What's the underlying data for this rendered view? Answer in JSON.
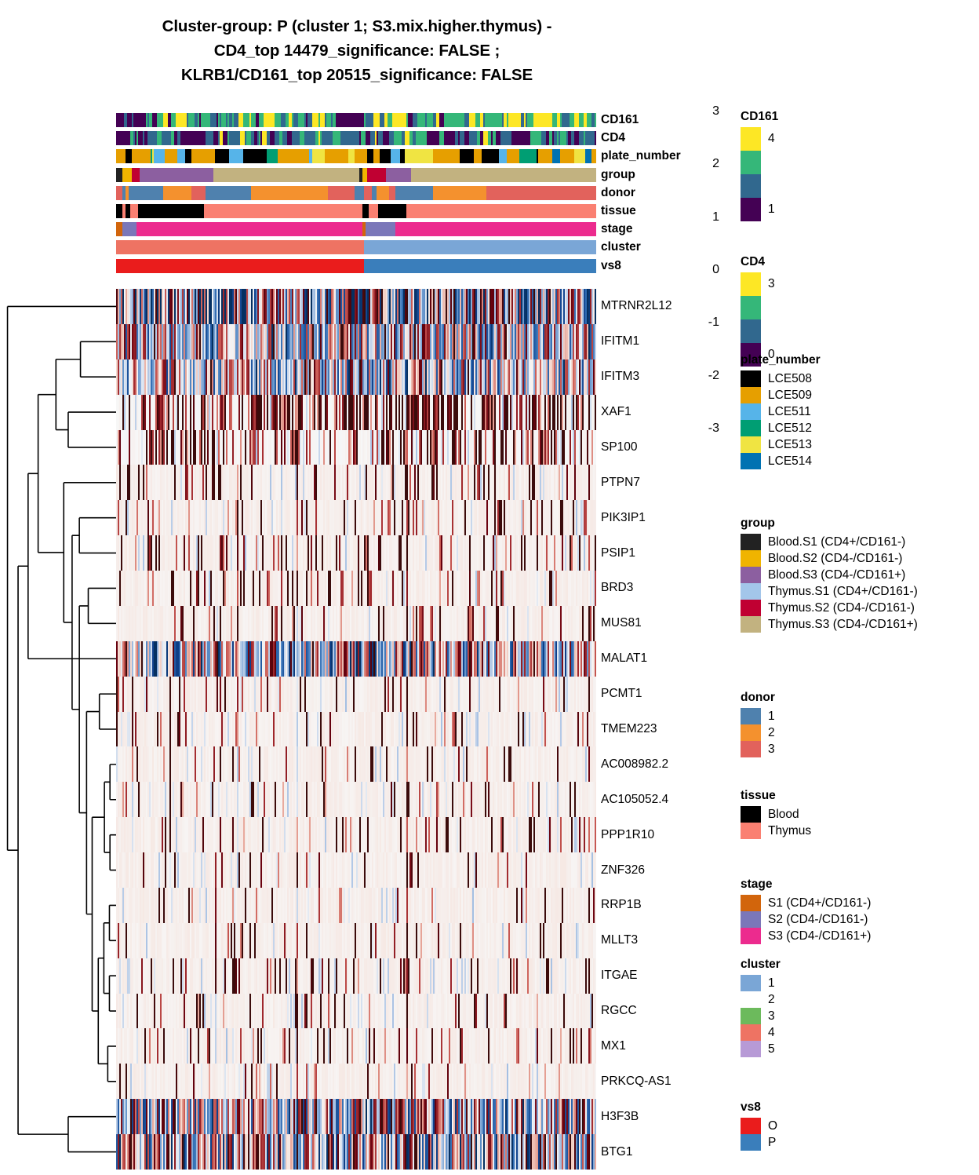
{
  "title": {
    "line1": "Cluster-group: P (cluster 1;  S3.mix.higher.thymus) -",
    "line2": "CD4_top 14479_significance: FALSE ;",
    "line3": "KLRB1/CD161_top 20515_significance: FALSE"
  },
  "annotation_tracks": [
    {
      "name": "CD161",
      "label": "CD161"
    },
    {
      "name": "CD4",
      "label": "CD4"
    },
    {
      "name": "plate_number",
      "label": "plate_number"
    },
    {
      "name": "group",
      "label": "group"
    },
    {
      "name": "donor",
      "label": "donor"
    },
    {
      "name": "tissue",
      "label": "tissue"
    },
    {
      "name": "stage",
      "label": "stage"
    },
    {
      "name": "cluster",
      "label": "cluster"
    },
    {
      "name": "vs8",
      "label": "vs8"
    }
  ],
  "colorbar": {
    "ticks": [
      "3",
      "2",
      "1",
      "0",
      "-1",
      "-2",
      "-3"
    ],
    "min": -3,
    "max": 3,
    "low_color": "#053061",
    "mid_color": "#f7f7f7",
    "high_color": "#3b0b0b"
  },
  "legends": [
    {
      "title": "CD161",
      "style": "stack",
      "items": [
        {
          "label": "4",
          "color": "#fde725"
        },
        {
          "label": "",
          "color": "#35b779"
        },
        {
          "label": "",
          "color": "#31688e"
        },
        {
          "label": "1",
          "color": "#440154"
        }
      ]
    },
    {
      "title": "CD4",
      "style": "stack",
      "items": [
        {
          "label": "3",
          "color": "#fde725"
        },
        {
          "label": "",
          "color": "#35b779"
        },
        {
          "label": "",
          "color": "#31688e"
        },
        {
          "label": "0",
          "color": "#440154"
        }
      ]
    },
    {
      "title": "plate_number",
      "style": "list",
      "items": [
        {
          "label": "LCE508",
          "color": "#000000"
        },
        {
          "label": "LCE509",
          "color": "#e69f00"
        },
        {
          "label": "LCE511",
          "color": "#56b4e9"
        },
        {
          "label": "LCE512",
          "color": "#009e73"
        },
        {
          "label": "LCE513",
          "color": "#f0e442"
        },
        {
          "label": "LCE514",
          "color": "#0072b2"
        }
      ]
    },
    {
      "title": "group",
      "style": "list",
      "items": [
        {
          "label": "Blood.S1 (CD4+/CD161-)",
          "color": "#222222"
        },
        {
          "label": "Blood.S2 (CD4-/CD161-)",
          "color": "#f0b400"
        },
        {
          "label": "Blood.S3 (CD4-/CD161+)",
          "color": "#8c5fa0"
        },
        {
          "label": "Thymus.S1 (CD4+/CD161-)",
          "color": "#a3c6ea"
        },
        {
          "label": "Thymus.S2 (CD4-/CD161-)",
          "color": "#c00032"
        },
        {
          "label": "Thymus.S3 (CD4-/CD161+)",
          "color": "#c2b280"
        }
      ]
    },
    {
      "title": "donor",
      "style": "list",
      "items": [
        {
          "label": "1",
          "color": "#4f81ae"
        },
        {
          "label": "2",
          "color": "#f4912e"
        },
        {
          "label": "3",
          "color": "#e2625c"
        }
      ]
    },
    {
      "title": "tissue",
      "style": "list",
      "items": [
        {
          "label": "Blood",
          "color": "#000000"
        },
        {
          "label": "Thymus",
          "color": "#fa8072"
        }
      ]
    },
    {
      "title": "stage",
      "style": "list",
      "items": [
        {
          "label": "S1 (CD4+/CD161-)",
          "color": "#d2650c"
        },
        {
          "label": "S2 (CD4-/CD161-)",
          "color": "#7b77b9"
        },
        {
          "label": "S3 (CD4-/CD161+)",
          "color": "#ec2b8e"
        }
      ]
    },
    {
      "title": "cluster",
      "style": "list",
      "items": [
        {
          "label": "1",
          "color": "#7aa6d6"
        },
        {
          "label": "2",
          "color": "#fca košice"
        },
        {
          "label": "3",
          "color": "#6cba5c"
        },
        {
          "label": "4",
          "color": "#ee7363"
        },
        {
          "label": "5",
          "color": "#b79ad6"
        }
      ]
    },
    {
      "title": "vs8",
      "style": "list",
      "items": [
        {
          "label": "O",
          "color": "#ea1c1c"
        },
        {
          "label": "P",
          "color": "#3a7ebb"
        }
      ]
    }
  ],
  "chart_data": {
    "type": "heatmap",
    "title": "Cluster-group: P (cluster 1;  S3.mix.higher.thymus) - CD4_top 14479_significance: FALSE ; KLRB1/CD161_top 20515_significance: FALSE",
    "xlabel": "",
    "ylabel": "",
    "zlim": [
      -3,
      3
    ],
    "colormap": "RdBu_r",
    "n_columns": 306,
    "row_labels": [
      "MTRNR2L12",
      "IFITM1",
      "IFITM3",
      "XAF1",
      "SP100",
      "PTPN7",
      "PIK3IP1",
      "PSIP1",
      "BRD3",
      "MUS81",
      "MALAT1",
      "PCMT1",
      "TMEM223",
      "AC008982.2",
      "AC105052.4",
      "PPP1R10",
      "ZNF326",
      "RRP1B",
      "MLLT3",
      "ITGAE",
      "RGCC",
      "MX1",
      "PRKCQ-AS1",
      "H3F3B",
      "BTG1"
    ],
    "row_activity": [
      0.95,
      0.72,
      0.74,
      0.55,
      0.44,
      0.2,
      0.17,
      0.16,
      0.15,
      0.13,
      0.8,
      0.12,
      0.1,
      0.09,
      0.09,
      0.11,
      0.1,
      0.09,
      0.1,
      0.12,
      0.11,
      0.13,
      0.1,
      0.78,
      0.88
    ],
    "row_bias": [
      -0.25,
      0.05,
      0.05,
      0.02,
      0.02,
      0.1,
      0.1,
      0.1,
      0.1,
      0.1,
      -0.05,
      0.1,
      0.1,
      0.1,
      0.1,
      0.1,
      0.1,
      0.1,
      0.1,
      0.1,
      0.1,
      0.1,
      0.1,
      0.02,
      0.0
    ],
    "legend_position": "right",
    "grid": false,
    "row_dendrogram": true,
    "column_split_fraction": 0.516
  },
  "annotation_data": {
    "n_columns": 306,
    "cluster": {
      "segments": [
        {
          "value": "4",
          "color": "#ee7363",
          "frac": 0.516
        },
        {
          "value": "1",
          "color": "#7aa6d6",
          "frac": 0.484
        }
      ]
    },
    "vs8": {
      "segments": [
        {
          "value": "O",
          "color": "#ea1c1c",
          "frac": 0.516
        },
        {
          "value": "P",
          "color": "#3a7ebb",
          "frac": 0.484
        }
      ]
    },
    "stage": {
      "segments": [
        {
          "value": "S1",
          "color": "#d2650c",
          "frac": 0.012
        },
        {
          "value": "S2",
          "color": "#7b77b9",
          "frac": 0.031
        },
        {
          "value": "S3",
          "color": "#ec2b8e",
          "frac": 0.47
        },
        {
          "value": "S1",
          "color": "#d2650c",
          "frac": 0.005
        },
        {
          "value": "S2",
          "color": "#7b77b9",
          "frac": 0.062
        },
        {
          "value": "S3",
          "color": "#ec2b8e",
          "frac": 0.42
        }
      ]
    },
    "tissue": {
      "segments": [
        {
          "value": "Blood",
          "color": "#000000",
          "frac": 0.012
        },
        {
          "value": "Thymus",
          "color": "#fa8072",
          "frac": 0.005
        },
        {
          "value": "Blood",
          "color": "#000000",
          "frac": 0.01
        },
        {
          "value": "Thymus",
          "color": "#fa8072",
          "frac": 0.016
        },
        {
          "value": "Blood",
          "color": "#000000",
          "frac": 0.138
        },
        {
          "value": "Thymus",
          "color": "#fa8072",
          "frac": 0.33
        },
        {
          "value": "Blood",
          "color": "#000000",
          "frac": 0.014
        },
        {
          "value": "Thymus",
          "color": "#fa8072",
          "frac": 0.02
        },
        {
          "value": "Blood",
          "color": "#000000",
          "frac": 0.06
        },
        {
          "value": "Thymus",
          "color": "#fa8072",
          "frac": 0.395
        }
      ]
    },
    "group": {
      "segments": [
        {
          "value": "Blood.S1",
          "color": "#222222",
          "frac": 0.012
        },
        {
          "value": "Blood.S2",
          "color": "#f0b400",
          "frac": 0.021
        },
        {
          "value": "Thymus.S2",
          "color": "#c00032",
          "frac": 0.016
        },
        {
          "value": "Blood.S3",
          "color": "#8c5fa0",
          "frac": 0.152
        },
        {
          "value": "Thymus.S3",
          "color": "#c2b280",
          "frac": 0.305
        },
        {
          "value": "Blood.S1",
          "color": "#222222",
          "frac": 0.007
        },
        {
          "value": "Blood.S2",
          "color": "#f0b400",
          "frac": 0.01
        },
        {
          "value": "Thymus.S2",
          "color": "#c00032",
          "frac": 0.039
        },
        {
          "value": "Blood.S3",
          "color": "#8c5fa0",
          "frac": 0.052
        },
        {
          "value": "Thymus.S3",
          "color": "#c2b280",
          "frac": 0.386
        }
      ]
    },
    "donor": {
      "segments": [
        {
          "value": "3",
          "color": "#e2625c",
          "frac": 0.012
        },
        {
          "value": "1",
          "color": "#4f81ae",
          "frac": 0.008
        },
        {
          "value": "2",
          "color": "#f4912e",
          "frac": 0.008
        },
        {
          "value": "1",
          "color": "#4f81ae",
          "frac": 0.072
        },
        {
          "value": "2",
          "color": "#f4912e",
          "frac": 0.06
        },
        {
          "value": "3",
          "color": "#e2625c",
          "frac": 0.03
        },
        {
          "value": "1",
          "color": "#4f81ae",
          "frac": 0.095
        },
        {
          "value": "2",
          "color": "#f4912e",
          "frac": 0.16
        },
        {
          "value": "3",
          "color": "#e2625c",
          "frac": 0.055
        },
        {
          "value": "1",
          "color": "#4f81ae",
          "frac": 0.02
        },
        {
          "value": "3",
          "color": "#e2625c",
          "frac": 0.016
        },
        {
          "value": "1",
          "color": "#4f81ae",
          "frac": 0.01
        },
        {
          "value": "2",
          "color": "#f4912e",
          "frac": 0.026
        },
        {
          "value": "3",
          "color": "#e2625c",
          "frac": 0.013
        },
        {
          "value": "1",
          "color": "#4f81ae",
          "frac": 0.078
        },
        {
          "value": "2",
          "color": "#f4912e",
          "frac": 0.11
        },
        {
          "value": "3",
          "color": "#e2625c",
          "frac": 0.227
        }
      ]
    },
    "plate_palette": [
      "#000000",
      "#e69f00",
      "#56b4e9",
      "#009e73",
      "#f0e442",
      "#0072b2"
    ],
    "cd161_palette": [
      "#440154",
      "#31688e",
      "#35b779",
      "#fde725"
    ],
    "cd4_palette": [
      "#440154",
      "#31688e",
      "#35b779",
      "#fde725"
    ]
  }
}
